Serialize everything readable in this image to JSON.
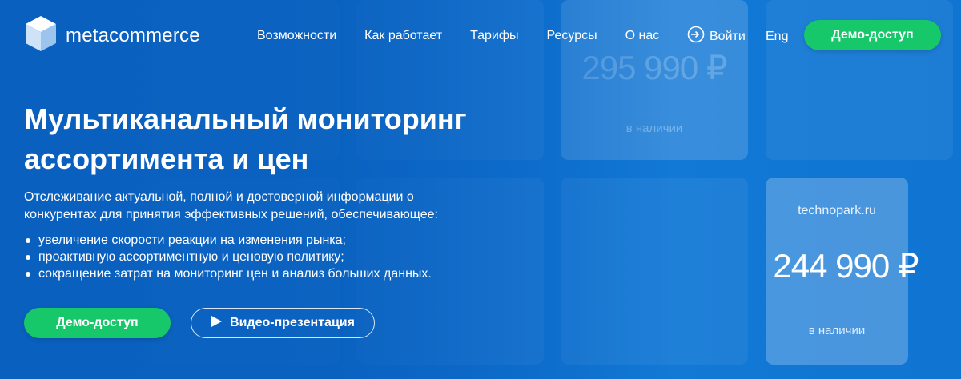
{
  "brand": {
    "name": "metacommerce"
  },
  "nav": {
    "items": [
      "Возможности",
      "Как работает",
      "Тарифы",
      "Ресурсы",
      "О нас"
    ],
    "login_label": "Войти",
    "lang_label": "Eng",
    "demo_label": "Демо-доступ"
  },
  "hero": {
    "title_line1": "Мультиканальный мониторинг",
    "title_line2": "ассортимента и цен",
    "lead": "Отслеживание актуальной, полной и достоверной информации о конкурентах для принятия эффективных решений, обеспечивающее:",
    "bullets": [
      "увеличение скорости реакции на изменения рынка;",
      "проактивную ассортиментную и ценовую политику;",
      "сокращение затрат на мониторинг цен и анализ больших данных."
    ],
    "demo_label": "Демо-доступ",
    "video_label": "Видео-презентация"
  },
  "cards": {
    "ghost_price": "295 990 ₽",
    "ghost_stock": "в наличии",
    "site": "technopark.ru",
    "price": "244 990 ₽",
    "stock": "в наличии"
  },
  "colors": {
    "background": "#0d6fd0",
    "accent_green": "#16c86a"
  },
  "icons": [
    "logo-cube-icon",
    "login-arrow-icon",
    "play-icon"
  ]
}
